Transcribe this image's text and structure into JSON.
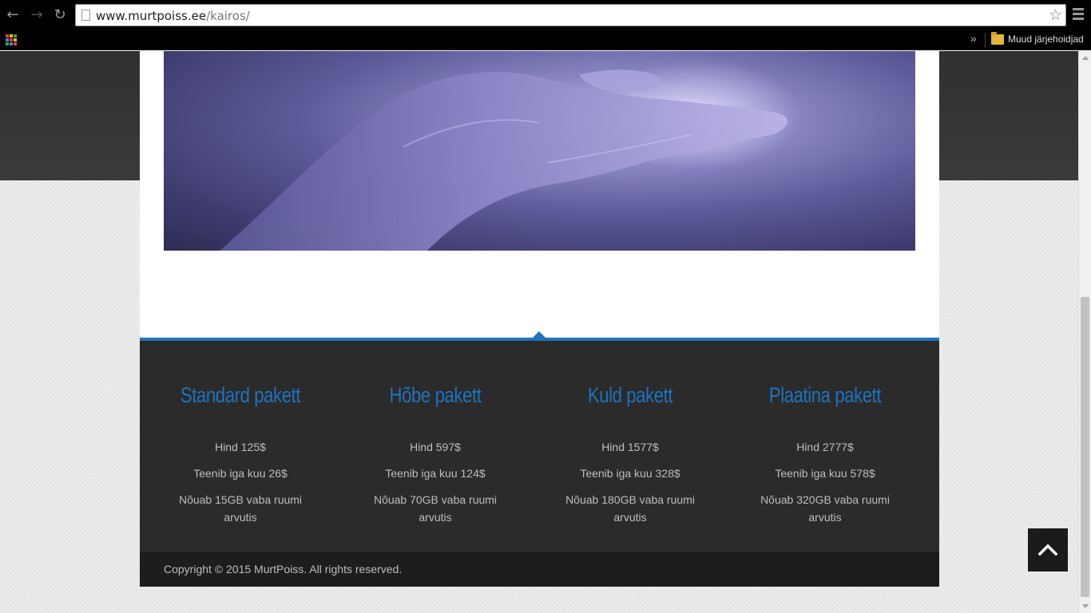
{
  "browser": {
    "url_host": "www.murtpoiss.ee",
    "url_path": "/kairos/",
    "bookmarks_more": "»",
    "other_bookmarks_label": "Muud järjehoidjad"
  },
  "packages": [
    {
      "title": "Standard pakett",
      "price": "Hind 125$",
      "earns": "Teenib iga kuu 26$",
      "requires": "Nõuab 15GB vaba ruumi arvutis"
    },
    {
      "title": "Hõbe pakett",
      "price": "Hind 597$",
      "earns": "Teenib iga kuu 124$",
      "requires": "Nõuab 70GB vaba ruumi arvutis"
    },
    {
      "title": "Kuld pakett",
      "price": "Hind 1577$",
      "earns": "Teenib iga kuu 328$",
      "requires": "Nõuab 180GB vaba ruumi arvutis"
    },
    {
      "title": "Plaatina pakett",
      "price": "Hind 2777$",
      "earns": "Teenib iga kuu 578$",
      "requires": "Nõuab 320GB vaba ruumi arvutis"
    }
  ],
  "footer": {
    "copyright": "Copyright © 2015 MurtPoiss. All rights reserved."
  },
  "colors": {
    "accent": "#1e73be",
    "pricing_bg": "#2b2b2b",
    "footer_bg": "#1d1d1d"
  },
  "icons": {
    "back": "arrow-left-icon",
    "forward": "arrow-right-icon",
    "reload": "reload-icon",
    "bookmark_star": "star-icon",
    "menu": "hamburger-menu-icon",
    "apps": "apps-grid-icon",
    "folder": "folder-icon",
    "back_to_top": "chevron-up-icon"
  }
}
